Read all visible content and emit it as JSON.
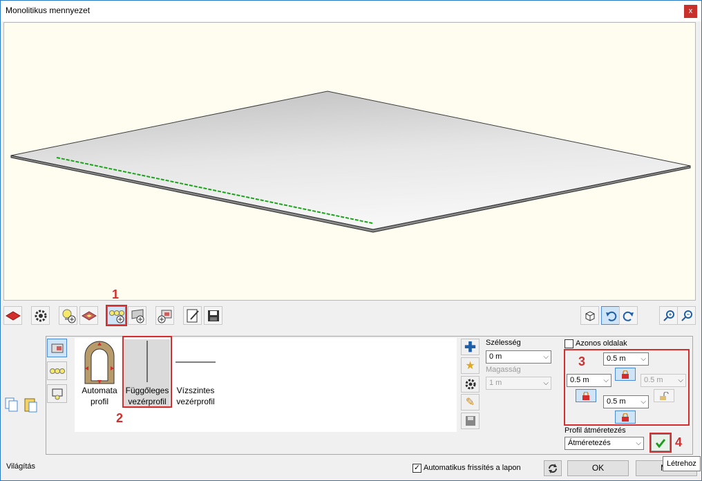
{
  "window": {
    "title": "Monolitikus mennyezet",
    "close_label": "x"
  },
  "viewport": {
    "slab_color": "#e4e4e4",
    "guide_color": "#19a319"
  },
  "annotations": {
    "n1": "1",
    "n2": "2",
    "n3": "3",
    "n4": "4"
  },
  "profiles": {
    "items": [
      {
        "line1": "Automata",
        "line2": "profil"
      },
      {
        "line1": "Függőleges",
        "line2": "vezérprofil"
      },
      {
        "line1": "Vízszintes",
        "line2": "vezérprofil"
      }
    ]
  },
  "size": {
    "width_label": "Szélesség",
    "width_value": "0 m",
    "height_label": "Magasság",
    "height_value": "1 m"
  },
  "sides": {
    "same_sides_label": "Azonos oldalak",
    "top_value": "0.5 m",
    "left_value": "0.5 m",
    "right_value": "0.5 m",
    "bottom_value": "0.5 m"
  },
  "resize": {
    "label": "Profil átméretezés",
    "value": "Átméretezés"
  },
  "footer": {
    "status": "Világítás",
    "auto_refresh_label": "Automatikus frissítés a lapon",
    "ok_label": "OK",
    "cancel_label": "Mé",
    "tooltip": "Létrehoz"
  },
  "colors": {
    "accent": "#2a79c4",
    "highlight_red": "#d32d2d"
  }
}
